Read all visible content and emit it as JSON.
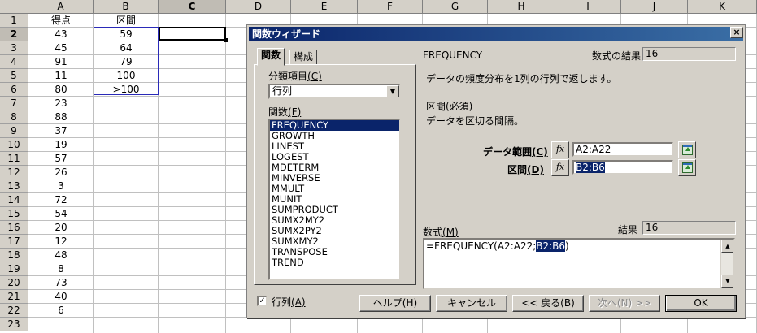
{
  "sheet": {
    "columns": [
      "A",
      "B",
      "C",
      "D",
      "E",
      "F",
      "G",
      "H",
      "I",
      "J",
      "K"
    ],
    "active_column": "C",
    "rows": [
      "1",
      "2",
      "3",
      "4",
      "5",
      "6",
      "7",
      "8",
      "9",
      "10",
      "11",
      "12",
      "13",
      "14",
      "15",
      "16",
      "17",
      "18",
      "19",
      "20",
      "21",
      "22",
      "23"
    ],
    "active_row": "2",
    "col_a": [
      "得点",
      "43",
      "45",
      "91",
      "11",
      "80",
      "23",
      "88",
      "37",
      "19",
      "57",
      "26",
      "3",
      "72",
      "54",
      "20",
      "12",
      "48",
      "8",
      "73",
      "40",
      "6"
    ],
    "col_b": [
      "区間",
      "59",
      "64",
      "79",
      "100",
      ">100"
    ]
  },
  "dialog": {
    "title": "関数ウィザード",
    "close_glyph": "×",
    "tabs": [
      "関数",
      "構成"
    ],
    "category_label": "分類項目",
    "category_accel": "(C)",
    "category_value": "行列",
    "function_label": "関数",
    "function_accel": "(F)",
    "functions": [
      "FREQUENCY",
      "GROWTH",
      "LINEST",
      "LOGEST",
      "MDETERM",
      "MINVERSE",
      "MMULT",
      "MUNIT",
      "SUMPRODUCT",
      "SUMX2MY2",
      "SUMX2PY2",
      "SUMXMY2",
      "TRANSPOSE",
      "TREND"
    ],
    "selected_function": "FREQUENCY",
    "function_name": "FREQUENCY",
    "formula_result_label": "数式の結果",
    "formula_result_value": "16",
    "description": "データの頻度分布を1列の行列で返します。",
    "param_name": "区間(必須)",
    "param_desc": "データを区切る間隔。",
    "args": [
      {
        "label": "データ範囲",
        "accel": "(C)",
        "value": "A2:A22",
        "highlight": false
      },
      {
        "label": "区間",
        "accel": "(D)",
        "value": "B2:B6",
        "highlight": true
      }
    ],
    "fx_glyph": "fx",
    "formula_label": "数式",
    "formula_accel": "(M)",
    "result_label": "結果",
    "result_value": "16",
    "formula_prefix": "=FREQUENCY(A2:A22;",
    "formula_highlight": "B2:B6",
    "formula_suffix": ")",
    "array_checkbox_label": "行列",
    "array_checkbox_accel": "(A)",
    "array_checked": true,
    "check_glyph": "✓",
    "buttons": {
      "help": "ヘルプ(H)",
      "cancel": "キャンセル",
      "back": "<< 戻る(B)",
      "next": "次へ(N) >>",
      "ok": "OK"
    }
  }
}
